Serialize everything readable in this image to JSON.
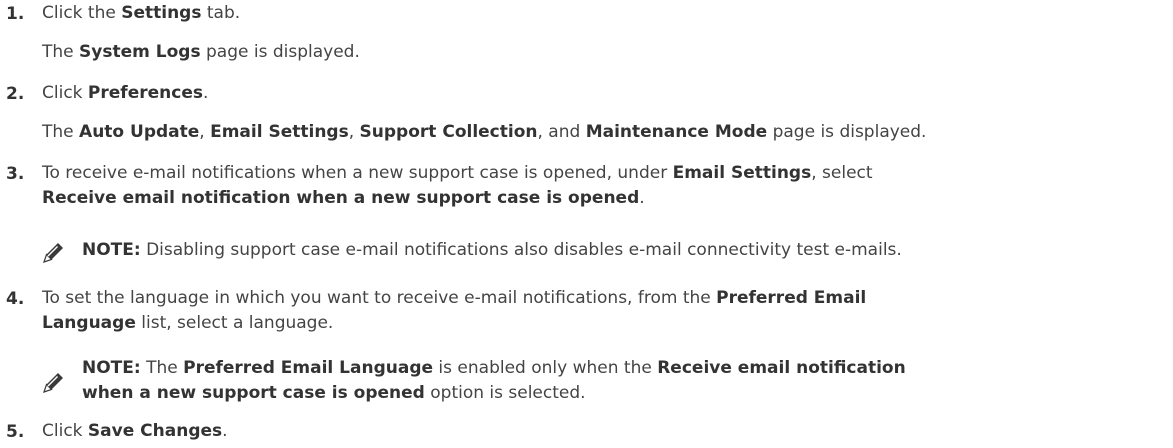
{
  "steps": [
    {
      "number": "1.",
      "lines": [
        [
          {
            "t": "Click the "
          },
          {
            "t": "Settings",
            "b": true
          },
          {
            "t": " tab."
          }
        ],
        [
          {
            "t": "The "
          },
          {
            "t": "System Logs",
            "b": true
          },
          {
            "t": " page is displayed."
          }
        ]
      ]
    },
    {
      "number": "2.",
      "lines": [
        [
          {
            "t": "Click "
          },
          {
            "t": "Preferences",
            "b": true
          },
          {
            "t": "."
          }
        ],
        [
          {
            "t": "The "
          },
          {
            "t": "Auto Update",
            "b": true
          },
          {
            "t": ", "
          },
          {
            "t": "Email Settings",
            "b": true
          },
          {
            "t": ", "
          },
          {
            "t": "Support Collection",
            "b": true
          },
          {
            "t": ", and "
          },
          {
            "t": "Maintenance Mode",
            "b": true
          },
          {
            "t": " page is displayed."
          }
        ]
      ]
    },
    {
      "number": "3.",
      "lines": [
        [
          {
            "t": "To receive e-mail notifications when a new support case is opened, under "
          },
          {
            "t": "Email Settings",
            "b": true
          },
          {
            "t": ", select"
          }
        ],
        [
          {
            "t": "Receive email notification when a new support case is opened",
            "b": true
          },
          {
            "t": "."
          }
        ]
      ],
      "note": {
        "icon": "note-pencil-icon",
        "label": "NOTE:",
        "lines": [
          [
            {
              "t": " Disabling support case e-mail notifications also disables e-mail connectivity test e-mails."
            }
          ]
        ]
      }
    },
    {
      "number": "4.",
      "lines": [
        [
          {
            "t": "To set the language in which you want to receive e-mail notifications, from the "
          },
          {
            "t": "Preferred Email",
            "b": true
          }
        ],
        [
          {
            "t": "Language",
            "b": true
          },
          {
            "t": " list, select a language."
          }
        ]
      ],
      "note": {
        "icon": "note-pencil-icon",
        "label": "NOTE:",
        "lines": [
          [
            {
              "t": " The "
            },
            {
              "t": "Preferred Email Language",
              "b": true
            },
            {
              "t": " is enabled only when the "
            },
            {
              "t": "Receive email notification",
              "b": true
            }
          ],
          [
            {
              "t": "when a new support case is opened",
              "b": true
            },
            {
              "t": " option is selected."
            }
          ]
        ]
      }
    },
    {
      "number": "5.",
      "lines": [
        [
          {
            "t": "Click "
          },
          {
            "t": "Save Changes",
            "b": true
          },
          {
            "t": "."
          }
        ]
      ]
    }
  ]
}
